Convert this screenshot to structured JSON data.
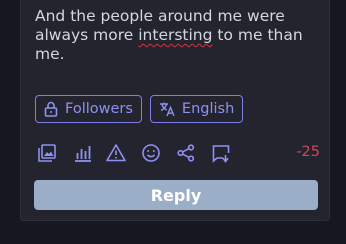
{
  "composer": {
    "text_before": "And the people around me were always more ",
    "misspelled_word": "intersting",
    "text_after": " to me than me."
  },
  "chips": {
    "visibility": {
      "label": "Followers",
      "icon": "lock-icon"
    },
    "language": {
      "label": "English",
      "icon": "translate-icon"
    }
  },
  "toolbar": {
    "icons": [
      "image-gallery-icon",
      "poll-icon",
      "warning-icon",
      "emoji-icon",
      "share-icon",
      "schedule-post-icon"
    ],
    "character_counter": "-25"
  },
  "reply_button": {
    "label": "Reply"
  },
  "colors": {
    "accent": "#8e91f2",
    "counter_negative": "#d04660",
    "reply_button_bg": "#9aaec8",
    "panel_bg": "#23242e",
    "page_bg": "#17181f"
  }
}
